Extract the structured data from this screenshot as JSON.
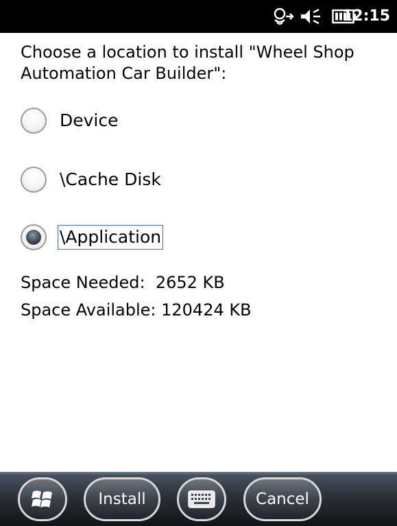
{
  "status_bar": {
    "time": "12:15",
    "icons": [
      "connectivity-icon",
      "speaker-muted-icon",
      "battery-icon"
    ]
  },
  "prompt": {
    "text": "Choose a location to install \"Wheel Shop Automation Car Builder\":"
  },
  "locations": [
    {
      "label": "Device",
      "selected": false
    },
    {
      "label": "\\Cache Disk",
      "selected": false
    },
    {
      "label": "\\Application",
      "selected": true
    }
  ],
  "space": {
    "needed": "Space Needed:  2652 KB",
    "available": "Space Available: 120424 KB"
  },
  "softkeys": {
    "start_icon": "windows-logo-icon",
    "install_label": "Install",
    "keyboard_icon": "keyboard-icon",
    "cancel_label": "Cancel"
  }
}
